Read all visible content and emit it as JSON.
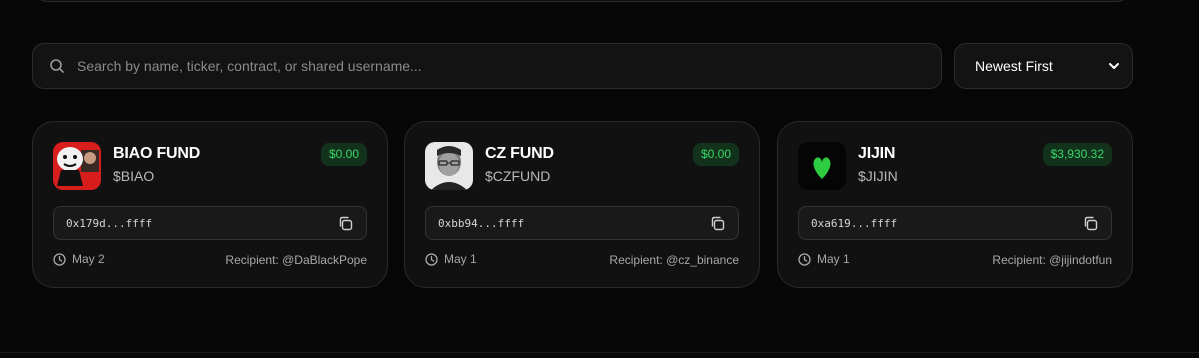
{
  "search": {
    "placeholder": "Search by name, ticker, contract, or shared username..."
  },
  "sort": {
    "selected": "Newest First"
  },
  "funds": [
    {
      "name": "BIAO FUND",
      "ticker": "$BIAO",
      "balance": "$0.00",
      "address": "0x179d...ffff",
      "date": "May 2",
      "recipient": "Recipient: @DaBlackPope",
      "avatar_icon": "cartoon-face-avatar"
    },
    {
      "name": "CZ FUND",
      "ticker": "$CZFUND",
      "balance": "$0.00",
      "address": "0xbb94...ffff",
      "date": "May 1",
      "recipient": "Recipient: @cz_binance",
      "avatar_icon": "portrait-photo-avatar"
    },
    {
      "name": "JIJIN",
      "ticker": "$JIJIN",
      "balance": "$3,930.32",
      "address": "0xa619...ffff",
      "date": "May 1",
      "recipient": "Recipient: @jijindotfun",
      "avatar_icon": "green-heart-avatar"
    }
  ],
  "colors": {
    "background": "#070707",
    "card": "#121111",
    "balance_text": "#3ad66b",
    "balance_bg": "#13321b",
    "heart": "#2ecc40"
  }
}
